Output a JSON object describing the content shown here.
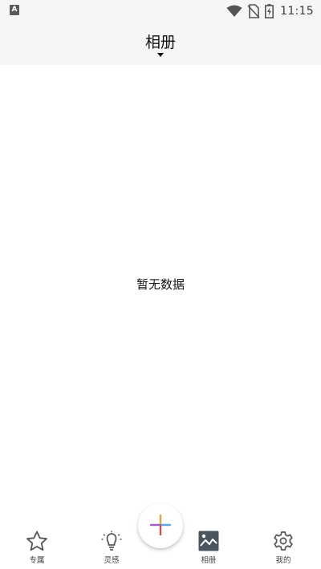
{
  "status_bar": {
    "left_icon_letter": "A",
    "time": "11:15",
    "icons": [
      "wifi-icon",
      "no-sim-icon",
      "battery-charging-icon"
    ]
  },
  "header": {
    "title": "相册",
    "dropdown_icon": "caret-down-icon"
  },
  "main": {
    "empty_text": "暂无数据"
  },
  "fab": {
    "icon": "plus-icon",
    "colors": [
      "#e0a64b",
      "#5aa6e6",
      "#a25dc4",
      "#d05050"
    ]
  },
  "tabs": [
    {
      "label": "专属",
      "icon": "star-icon",
      "active": false
    },
    {
      "label": "灵感",
      "icon": "lightbulb-icon",
      "active": false
    },
    {
      "label": "相册",
      "icon": "album-icon",
      "active": true
    },
    {
      "label": "我的",
      "icon": "gear-icon",
      "active": false
    }
  ],
  "colors": {
    "active_tab": "#4a5560",
    "inactive_tab": "#555555",
    "header_bg": "#f6f6f6"
  }
}
